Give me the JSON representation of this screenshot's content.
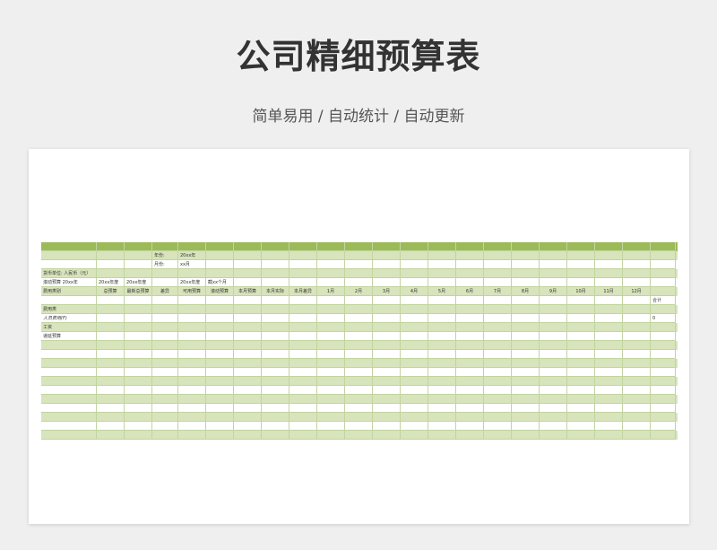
{
  "header": {
    "title": "公司精细预算表",
    "subtitle": "简单易用 / 自动统计 / 自动更新"
  },
  "sheet": {
    "year_label": "年份:",
    "year_value": "20xx年",
    "month_label": "月份:",
    "month_value": "xx月",
    "currency": "货币单位: 人民币（元）",
    "rolling_label": "滚动预算 20xx年",
    "col_year1": "20xx年度",
    "col_year2": "20xx年度",
    "col_year3": "20xx年度",
    "col_sofar": "截xx个月",
    "headers": [
      "费用类别",
      "总预算",
      "最新总预算",
      "差异",
      "可用预算",
      "滚动预算",
      "本月预算",
      "本月实际",
      "本月差异",
      "1月",
      "2月",
      "3月",
      "4月",
      "5月",
      "6月",
      "7月",
      "8月",
      "9月",
      "10月",
      "11月",
      "12月"
    ],
    "total_label": "合计",
    "row_expense": "费用类",
    "row_personnel": "人员费用(F)",
    "row_personnel_val": "0",
    "row_salary": "工资",
    "row_bonus": "递延预算"
  },
  "colors": {
    "accent": "#9bbb59",
    "alt_row": "#d8e4bc"
  }
}
